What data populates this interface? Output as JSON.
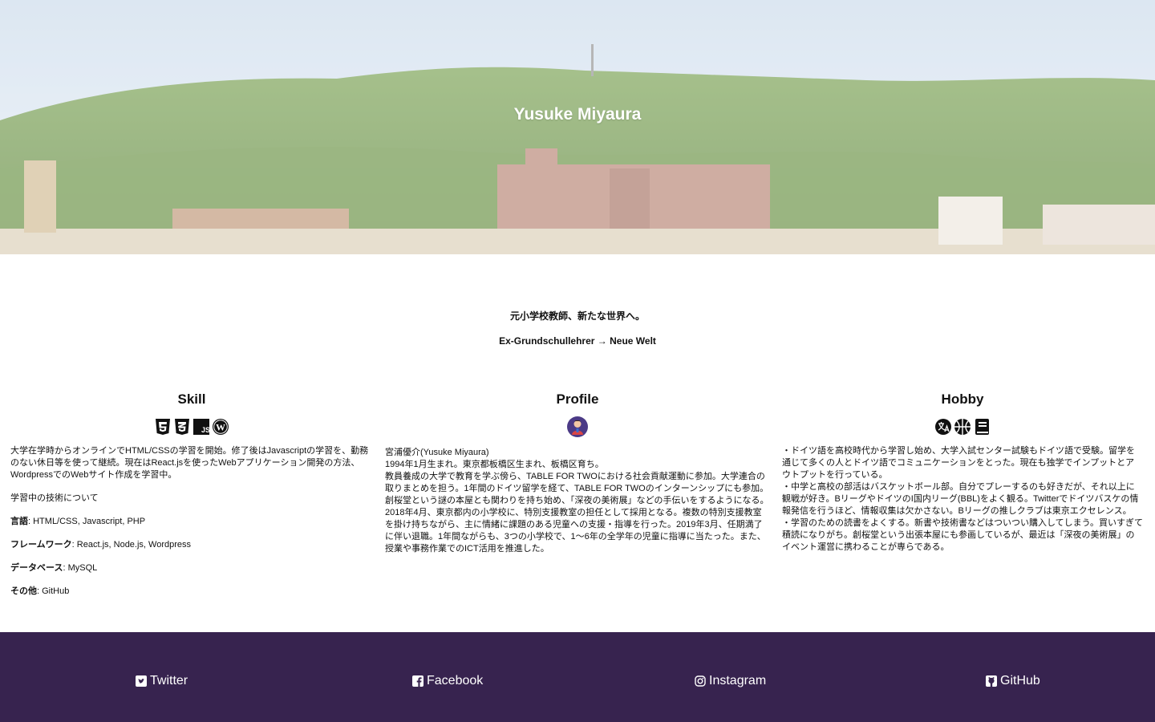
{
  "hero": {
    "title": "Yusuke Miyaura"
  },
  "tagline": {
    "jp": "元小学校教師、新たな世界へ。",
    "de": "Ex-Grundschullehrer → Neue Welt"
  },
  "skill": {
    "title": "Skill",
    "icons": [
      "html5-icon",
      "css3-icon",
      "javascript-icon",
      "wordpress-icon"
    ],
    "intro": "大学在学時からオンラインでHTML/CSSの学習を開始。修了後はJavascriptの学習を、勤務のない休日等を使って継続。現在はReact.jsを使ったWebアプリケーション開発の方法、WordpressでのWebサイト作成を学習中。",
    "learning_heading": "学習中の技術について",
    "items": [
      {
        "label": "言語",
        "value": ": HTML/CSS, Javascript, PHP"
      },
      {
        "label": "フレームワーク",
        "value": ": React.js, Node.js, Wordpress"
      },
      {
        "label": "データベース",
        "value": ": MySQL"
      },
      {
        "label": "その他",
        "value": ": GitHub"
      }
    ]
  },
  "profile": {
    "title": "Profile",
    "avatar": "avatar-icon",
    "lines": [
      "宮浦優介(Yusuke Miyaura)",
      "1994年1月生まれ。東京都板橋区生まれ、板橋区育ち。",
      "教員養成の大学で教育を学ぶ傍ら、TABLE FOR TWOにおける社会貢献運動に参加。大学連合の取りまとめを担う。1年間のドイツ留学を経て、TABLE FOR TWOのインターンシップにも参加。創桜堂という謎の本屋とも関わりを持ち始め、「深夜の美術展」などの手伝いをするようになる。",
      "2018年4月、東京都内の小学校に、特別支援教室の担任として採用となる。複数の特別支援教室を掛け持ちながら、主に情緒に課題のある児童への支援・指導を行った。2019年3月、任期満了に伴い退職。1年間ながらも、3つの小学校で、1〜6年の全学年の児童に指導に当たった。また、授業や事務作業でのICT活用を推進した。"
    ]
  },
  "hobby": {
    "title": "Hobby",
    "icons": [
      "language-icon",
      "basketball-icon",
      "book-icon"
    ],
    "items": [
      "・ドイツ語を高校時代から学習し始め、大学入試センター試験もドイツ語で受験。留学を通じて多くの人とドイツ語でコミュニケーションをとった。現在も独学でインプットとアウトプットを行っている。",
      "・中学と高校の部活はバスケットボール部。自分でプレーするのも好きだが、それ以上に観戦が好き。BリーグやドイツのI国内リーグ(BBL)をよく観る。Twitterでドイツバスケの情報発信を行うほど、情報収集は欠かさない。Bリーグの推しクラブは東京エクセレンス。",
      "・学習のための読書をよくする。新書や技術書などはついつい購入してしまう。買いすぎて積読になりがち。創桜堂という出張本屋にも参画しているが、最近は「深夜の美術展」のイベント運営に携わることが専らである。"
    ]
  },
  "footer": {
    "background": "#37234f",
    "links": [
      {
        "icon": "twitter-icon",
        "label": "Twitter"
      },
      {
        "icon": "facebook-icon",
        "label": "Facebook"
      },
      {
        "icon": "instagram-icon",
        "label": "Instagram"
      },
      {
        "icon": "github-icon",
        "label": "GitHub"
      }
    ]
  }
}
